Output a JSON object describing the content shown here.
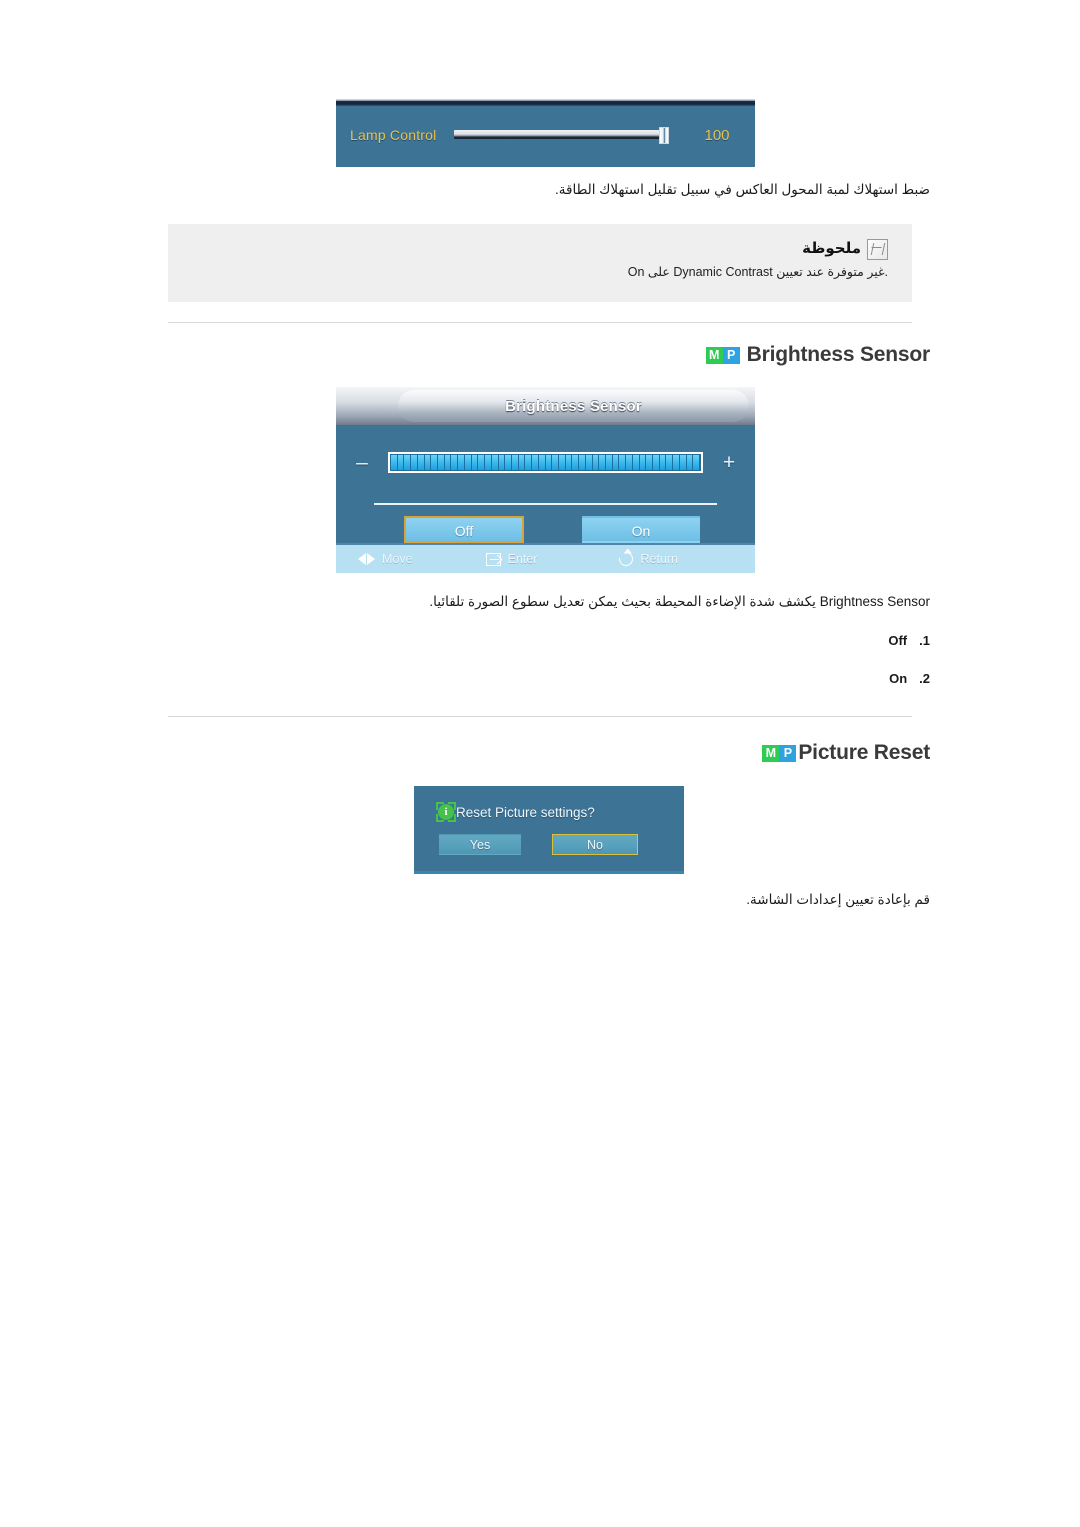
{
  "lamp_osd": {
    "label": "Lamp Control",
    "value": "100",
    "slider_percent": 100
  },
  "lamp_caption": "ضبط استهلاك لمبة المحول العاكس في سبيل تقليل استهلاك الطاقة.",
  "note": {
    "title": "ملحوظة",
    "icon": "note-pencil-icon",
    "body": ".غير متوفرة عند تعيين Dynamic Contrast على On"
  },
  "sections": {
    "brightness_sensor": {
      "badge_m": "M",
      "badge_p": "P",
      "title": "Brightness Sensor"
    },
    "picture_reset": {
      "badge_m": "M",
      "badge_p": "P",
      "title": "Picture Reset"
    }
  },
  "brightness_osd": {
    "title": "Brightness Sensor",
    "minus": "–",
    "plus": "+",
    "slider_segments": 46,
    "slider_percent": 100,
    "button_off": "Off",
    "button_on": "On",
    "selected_button": "Off",
    "footer": {
      "move": "Move",
      "enter": "Enter",
      "return": "Return"
    }
  },
  "brightness_caption": "Brightness Sensor يكشف شدة الإضاءة المحيطة بحيث يمكن تعديل سطوع الصورة تلقائيا.",
  "brightness_options": [
    {
      "num": "1.",
      "label": "Off"
    },
    {
      "num": "2.",
      "label": "On"
    }
  ],
  "picture_reset_osd": {
    "info_icon": "info-icon",
    "message": "Reset Picture settings?",
    "button_yes": "Yes",
    "button_no": "No",
    "selected_button": "No"
  },
  "picture_reset_caption": "قم بإعادة تعيين إعدادات الشاشة.",
  "colors": {
    "osd_background": "#3d7496",
    "osd_accent_amber": "#e9c04a",
    "slider_cyan": "#3fbdf0",
    "highlight_border": "#d9a33a",
    "badge_green": "#2fcc53",
    "badge_blue": "#2fa2e0",
    "note_background": "#efefef",
    "info_green": "#46c24a"
  }
}
